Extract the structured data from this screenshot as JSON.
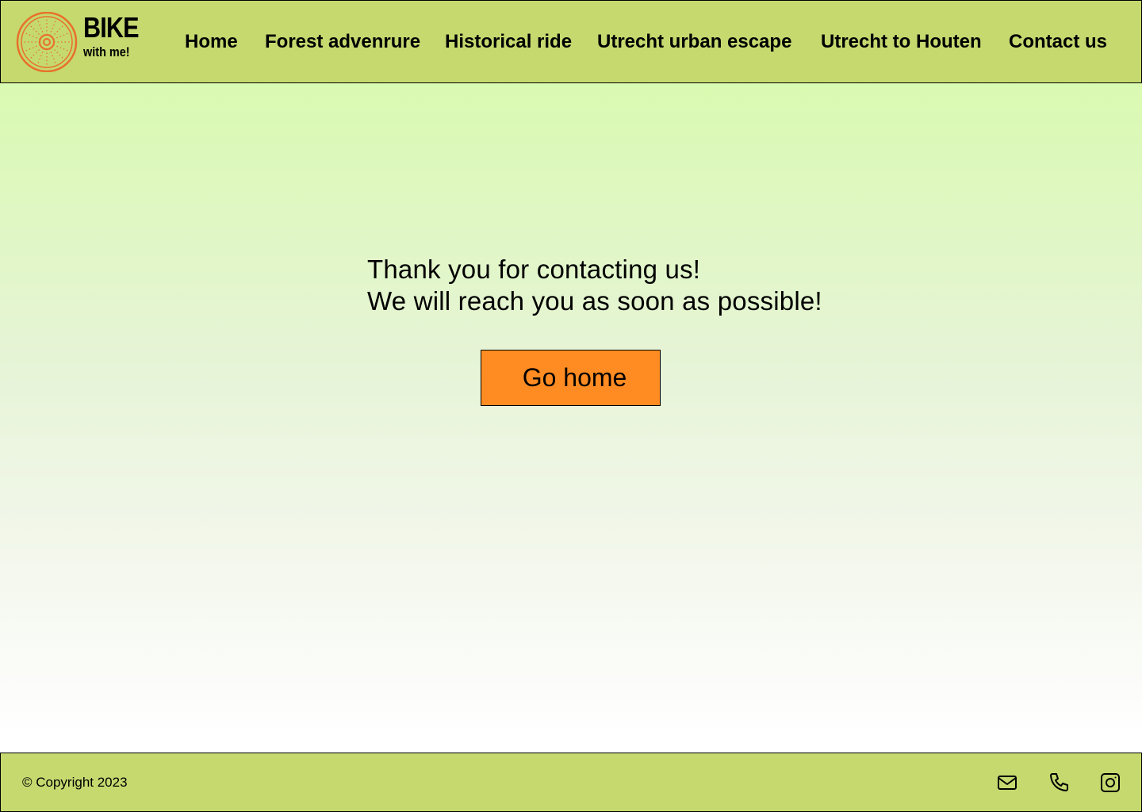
{
  "header": {
    "logo": {
      "title": "BIKE",
      "subtitle": "with me!",
      "icon": "bike-wheel-logo",
      "accent_color": "#e8702a"
    },
    "nav": [
      {
        "label": "Home"
      },
      {
        "label": "Forest advenrure"
      },
      {
        "label": "Historical ride"
      },
      {
        "label": "Utrecht urban escape"
      },
      {
        "label": "Utrecht to Houten"
      },
      {
        "label": "Contact us"
      }
    ],
    "background_color": "#c5d96f"
  },
  "main": {
    "message_line1": "Thank you for contacting us!",
    "message_line2": "We will reach you as soon as possible!",
    "button_label": "Go home",
    "button_color": "#ff8c22"
  },
  "footer": {
    "copyright": "© Copyright 2023",
    "icons": [
      "mail-icon",
      "phone-icon",
      "instagram-icon"
    ]
  }
}
